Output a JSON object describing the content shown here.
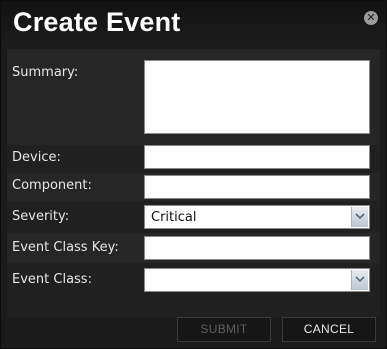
{
  "dialog": {
    "title": "Create Event",
    "close_icon": "close-icon"
  },
  "form": {
    "summary": {
      "label": "Summary:",
      "value": ""
    },
    "device": {
      "label": "Device:",
      "value": ""
    },
    "component": {
      "label": "Component:",
      "value": ""
    },
    "severity": {
      "label": "Severity:",
      "value": "Critical"
    },
    "event_class_key": {
      "label": "Event Class Key:",
      "value": ""
    },
    "event_class": {
      "label": "Event Class:",
      "value": ""
    }
  },
  "buttons": {
    "submit": "SUBMIT",
    "cancel": "CANCEL"
  },
  "colors": {
    "dialog_bg": "#1b1b1b",
    "title_text": "#ffffff",
    "disabled_text": "#5e5e5e"
  }
}
